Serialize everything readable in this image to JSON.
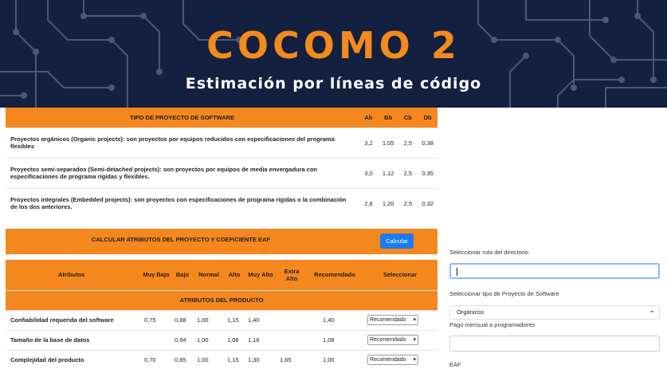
{
  "header": {
    "title": "COCOMO 2",
    "subtitle": "Estimación por líneas de código"
  },
  "project_types": {
    "columns": [
      "TIPO DE PROYECTO DE SOFTWARE",
      "Ab",
      "Bb",
      "Cb",
      "Db"
    ],
    "rows": [
      {
        "label": "Proyectos orgánicos (Organic projects): son proyectos por equipos reducidos con especificaciones del programa flexibles",
        "values": [
          "3,2",
          "1,05",
          "2,5",
          "0,38"
        ]
      },
      {
        "label": "Proyectos semi-separados (Semi-detached projects): son proyectos por equipos de media envergadura con especificaciones de programa rígidas y flexibles.",
        "values": [
          "3,0",
          "1,12",
          "2,5",
          "0,35"
        ]
      },
      {
        "label": "Proyectos integrales (Embedded projects): son proyectos con especificaciones de programa rígidas o la combinación de los dos anteriores.",
        "values": [
          "2,8",
          "1,20",
          "2,5",
          "0,32"
        ]
      }
    ]
  },
  "calc": {
    "label": "CALCULAR ATRIBUTOS DEL PROYECTO Y COEFICIENTE EAF",
    "button": "Calcular"
  },
  "attributes": {
    "columns": [
      "Atributos",
      "Muy Bajo",
      "Bajo",
      "Normal",
      "Alto",
      "Muy Alto",
      "Extra Alto",
      "Recomendado",
      "Seleccionar"
    ],
    "section": "ATRIBUTOS DEL PRODUCTO",
    "rows": [
      {
        "name": "Confiabilidad requerida del software",
        "values": [
          "0,75",
          "0,88",
          "1,00",
          "1,15",
          "1,40",
          "",
          "1,40"
        ],
        "select": "Recomendado"
      },
      {
        "name": "Tamaño de la base de datos",
        "values": [
          "",
          "0,94",
          "1,00",
          "1,08",
          "1,16",
          "",
          "1,08"
        ],
        "select": "Recomendado"
      },
      {
        "name": "Complejidad del producto",
        "values": [
          "0,70",
          "0,85",
          "1,00",
          "1,15",
          "1,30",
          "1,65",
          "1,00"
        ],
        "select": "Recomendado"
      }
    ]
  },
  "sidebar": {
    "dir_label": "Seleccionar ruta del directorio",
    "dir_value": "",
    "type_label": "Seleccionar tipo de Proyecto de Software",
    "type_value": "Orgánicos",
    "pay_label": "Pago mensual a programadores",
    "pay_value": "",
    "eaf_label": "EAF"
  },
  "colors": {
    "accent": "#f5871f",
    "banner": "#13203f",
    "button": "#1a7bf5"
  }
}
